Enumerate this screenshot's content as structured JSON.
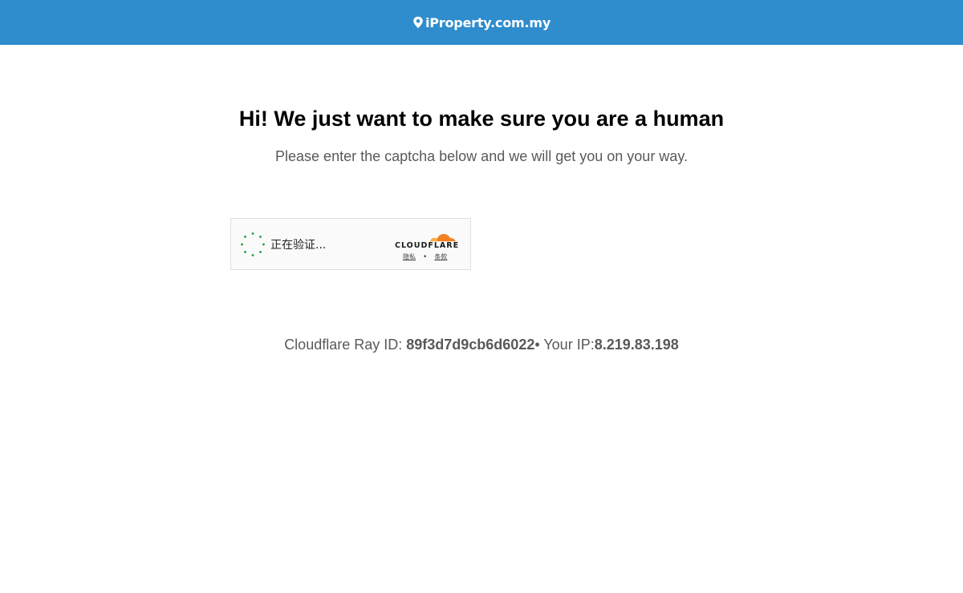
{
  "header": {
    "logo_text": "iProperty.com.my",
    "logo_icon": "map-pin-icon",
    "background_color": "#2f8ccd"
  },
  "main": {
    "title": "Hi! We just want to make sure you are a human",
    "subtitle": "Please enter the captcha below and we will get you on your way."
  },
  "captcha": {
    "status_text": "正在验证...",
    "spinner_icon": "loading-spinner-icon",
    "spinner_color": "#1a9c3e",
    "provider_logo": "cloudflare-cloud-icon",
    "provider_name": "CLOUDFLARE",
    "privacy_link": "隐私",
    "separator": "•",
    "terms_link": "条款",
    "brand_color": "#f48120"
  },
  "footer": {
    "ray_label": "Cloudflare Ray ID: ",
    "ray_id": "89f3d7d9cb6d6022",
    "ip_label": "• Your IP:",
    "ip": "8.219.83.198"
  }
}
